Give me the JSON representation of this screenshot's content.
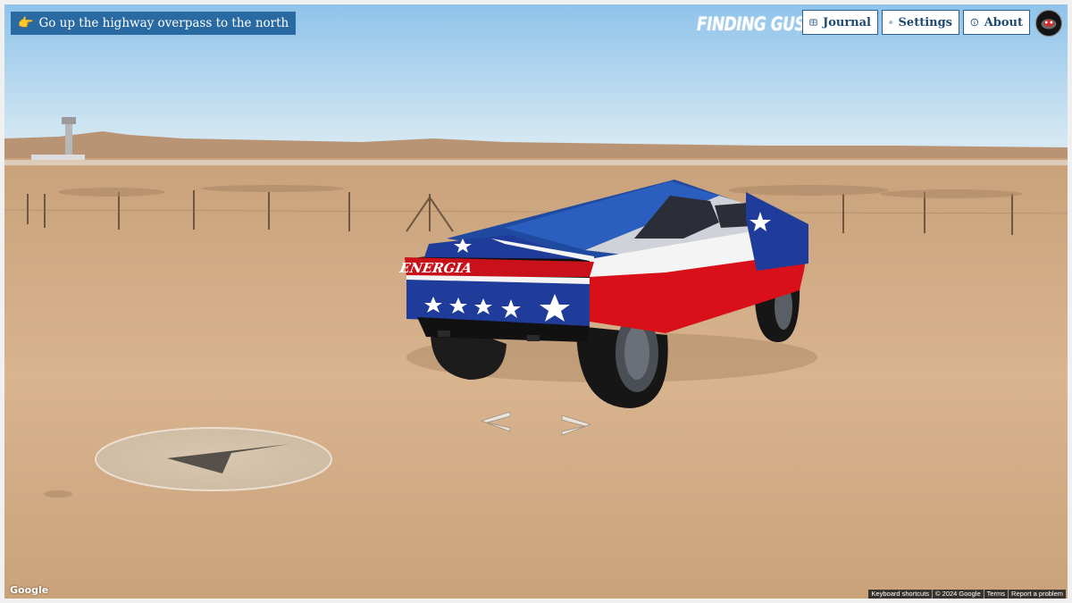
{
  "hint": {
    "icon": "pointing-hand-icon",
    "text": "Go up the highway overpass to the north"
  },
  "brand": "FINDING GUSTAVO",
  "nav": {
    "journal": {
      "label": "Journal",
      "icon": "journal-icon"
    },
    "settings": {
      "label": "Settings",
      "icon": "gear-icon"
    },
    "about": {
      "label": "About",
      "icon": "info-icon"
    }
  },
  "vehicle": {
    "livery_text": "ENERGIA"
  },
  "attribution": {
    "logo": "Google",
    "keyboard": "Keyboard shortcuts",
    "copyright": "© 2024 Google",
    "terms": "Terms",
    "report": "Report a problem"
  },
  "colors": {
    "accent": "#2a6aa3",
    "button_text": "#1e4a72",
    "sky": "#bfe0f4",
    "desert": "#cfa982"
  }
}
